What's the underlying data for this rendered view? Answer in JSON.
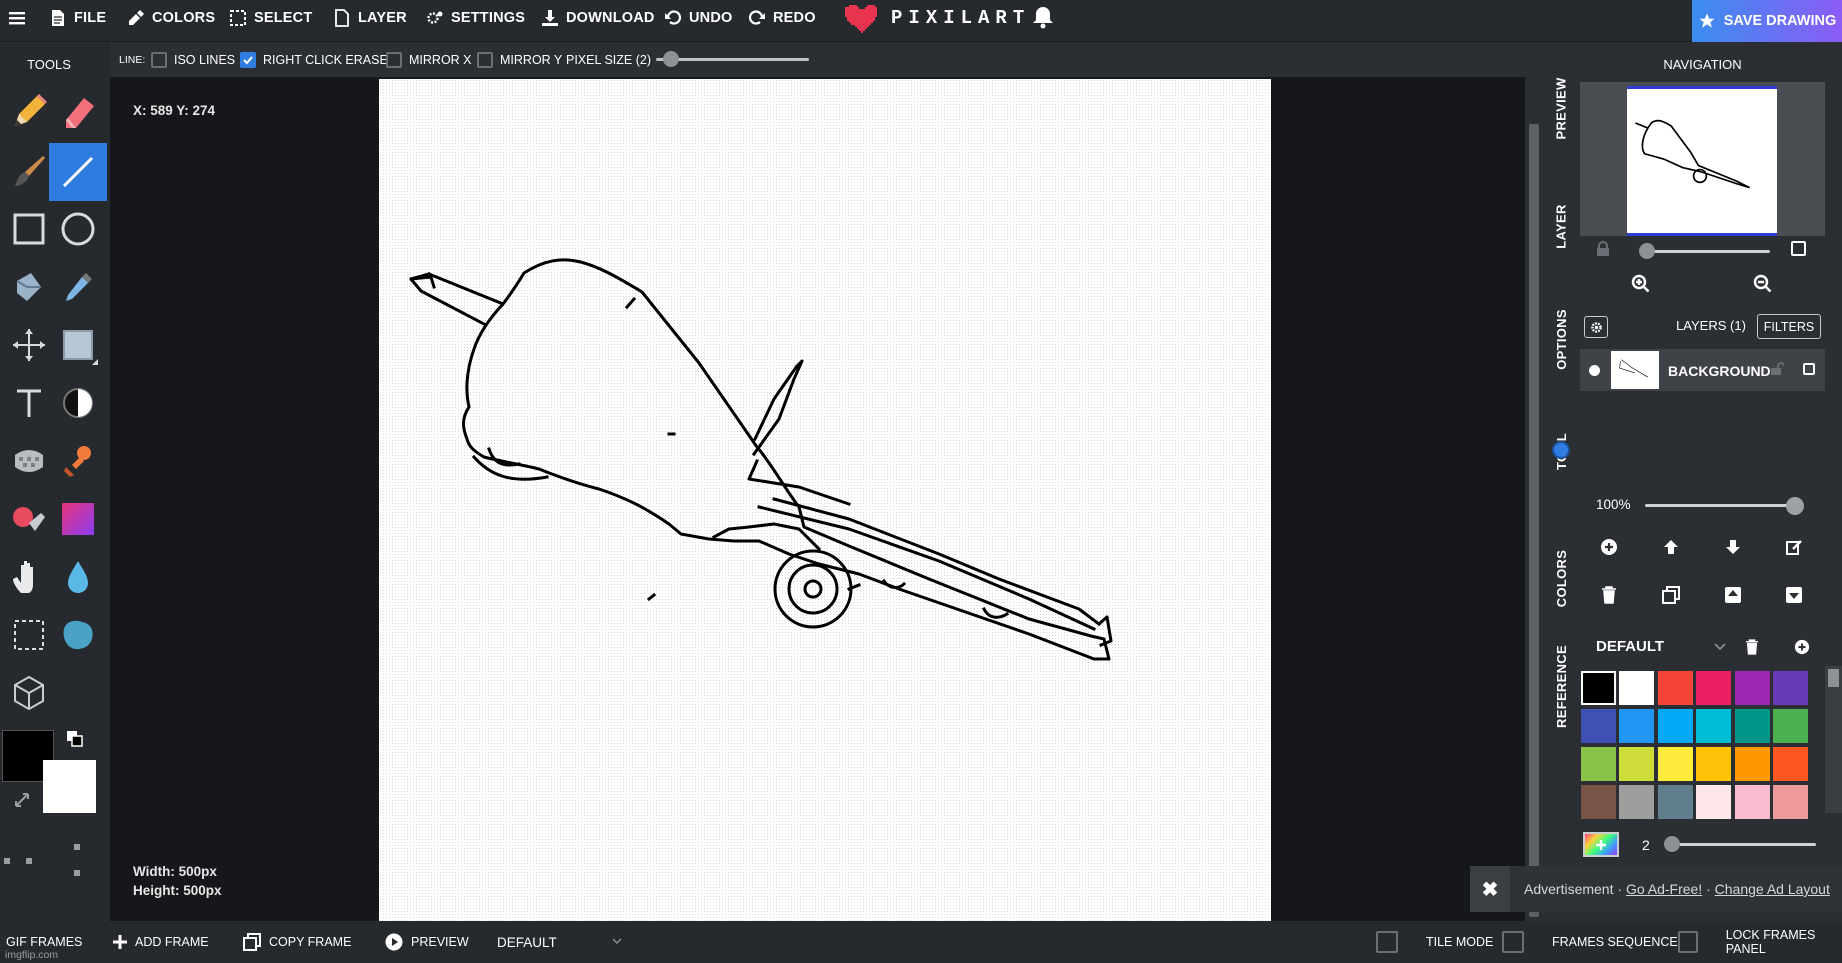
{
  "topbar": {
    "menu_icon": "hamburger-menu-icon",
    "items": [
      {
        "label": "FILE",
        "icon": "file-icon"
      },
      {
        "label": "COLORS",
        "icon": "eyedropper-icon"
      },
      {
        "label": "SELECT",
        "icon": "select-icon"
      },
      {
        "label": "LAYER",
        "icon": "layer-icon"
      },
      {
        "label": "SETTINGS",
        "icon": "gears-icon"
      },
      {
        "label": "DOWNLOAD",
        "icon": "download-icon"
      },
      {
        "label": "UNDO",
        "icon": "undo-icon"
      },
      {
        "label": "REDO",
        "icon": "redo-icon"
      }
    ],
    "logo": "PIXILART",
    "save_label": "SAVE DRAWING",
    "accent": "#2f7de1"
  },
  "tools": {
    "title": "TOOLS",
    "list": [
      "pencil-tool",
      "eraser-tool",
      "brush-tool",
      "line-tool",
      "rectangle-tool",
      "circle-tool",
      "fill-bucket-tool",
      "eyedropper-tool",
      "move-tool",
      "select-rect-tool",
      "text-tool",
      "lighten-darken-tool",
      "dither-tool",
      "stamp-tool",
      "paint-mix-tool",
      "gradient-tool",
      "pan-hand-tool",
      "blur-drop-tool",
      "marquee-tool",
      "blob-tool",
      "cube-3d-tool"
    ],
    "active": "line-tool",
    "primary_color": "#000000",
    "secondary_color": "#ffffff"
  },
  "options": {
    "line_label": "LINE:",
    "iso_lines": "ISO LINES",
    "right_click_erase": "RIGHT CLICK ERASE",
    "mirror_x": "MIRROR X",
    "mirror_y": "MIRROR Y",
    "pixel_size": "PIXEL SIZE (2)",
    "right_click_checked": true
  },
  "canvas": {
    "coords": "X: 589 Y: 274",
    "width": "Width: 500px",
    "height": "Height: 500px"
  },
  "sidetabs": [
    "PREVIEW",
    "LAYER",
    "OPTIONS",
    "TOOL",
    "COLORS",
    "REFERENCE"
  ],
  "navigation": {
    "title": "NAVIGATION",
    "zoom_in_icon": "zoom-in-icon",
    "zoom_out_icon": "zoom-out-icon"
  },
  "layers": {
    "title": "LAYERS (1)",
    "filters": "FILTERS",
    "items": [
      {
        "name": "BACKGROUND"
      }
    ],
    "opacity": "100%"
  },
  "palette": {
    "name": "DEFAULT",
    "swatches": [
      "#000000",
      "#ffffff",
      "#f44336",
      "#e91e63",
      "#9c27b0",
      "#673ab7",
      "#3f51b5",
      "#2196f3",
      "#03a9f4",
      "#00bcd4",
      "#009688",
      "#4caf50",
      "#8bc34a",
      "#cddc39",
      "#ffeb3b",
      "#ffc107",
      "#ff9800",
      "#ff5722",
      "#795548",
      "#9e9e9e",
      "#607d8b",
      "#fde7e9",
      "#f8bbd0",
      "#ef9a9a"
    ],
    "brush_size": "2"
  },
  "ad": {
    "label": "Advertisement ·",
    "go_ad_free": "Go Ad-Free!",
    "sep": "·",
    "change_layout": "Change Ad Layout"
  },
  "bottombar": {
    "gif_frames": "GIF FRAMES",
    "add_frame": "ADD FRAME",
    "copy_frame": "COPY FRAME",
    "preview": "PREVIEW",
    "default": "DEFAULT",
    "tile_mode": "TILE MODE",
    "frames_sequence": "FRAMES SEQUENCE",
    "lock_frames": "LOCK FRAMES PANEL",
    "watermark": "imgflip.com"
  }
}
